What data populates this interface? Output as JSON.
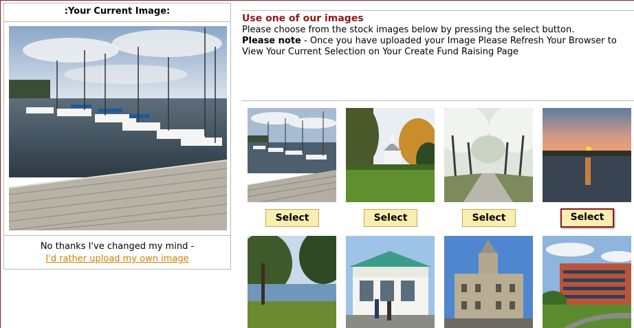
{
  "current_panel": {
    "title": ":Your Current Image:",
    "decline_text": "No thanks I've changed my mind -",
    "upload_link": "I'd rather upload my own image"
  },
  "stock_panel": {
    "heading": "Use one of our images",
    "instructions": "Please choose from the stock images below by pressing the select button.",
    "note_label": "Please note",
    "note_text": " - Once you have uploaded your Image Please Refresh Your Browser to View Your Current Selection on Your Create Fund Raising Page"
  },
  "images": [
    {
      "icon": "harbor-photo",
      "select_label": "Select"
    },
    {
      "icon": "church-photo",
      "select_label": "Select"
    },
    {
      "icon": "blossom-avenue-photo",
      "select_label": "Select"
    },
    {
      "icon": "sunset-lake-photo",
      "select_label": "Select",
      "highlighted": true
    },
    {
      "icon": "lakeside-trees-photo"
    },
    {
      "icon": "ice-cream-stand-photo"
    },
    {
      "icon": "historic-building-photo"
    },
    {
      "icon": "campus-building-photo"
    }
  ],
  "colors": {
    "accent": "#8b1a1a",
    "link": "#d08000",
    "button_bg": "#f9edb0",
    "button_border": "#c9a94a"
  }
}
